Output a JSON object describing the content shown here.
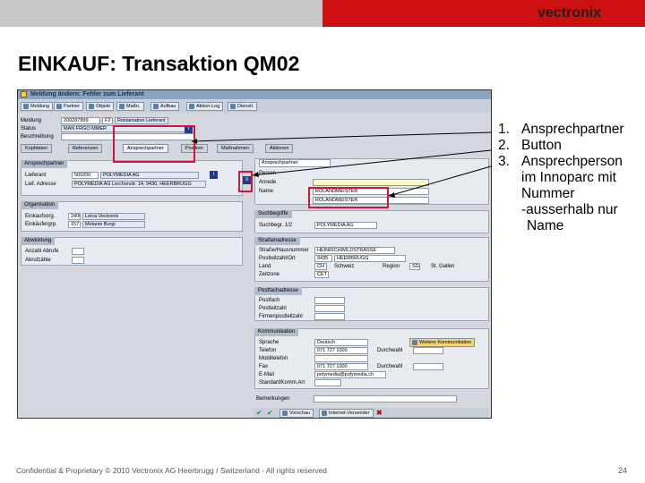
{
  "header": {
    "logo": "vectronix",
    "title": "EINKAUF: Transaktion QM02"
  },
  "footer": {
    "text": "Confidential & Proprietary © 2010 Vectronix AG Heerbrugg / Switzerland - All rights reserved",
    "page": "24"
  },
  "callouts": [
    {
      "num": "1.",
      "lines": [
        "Ansprechpartner"
      ]
    },
    {
      "num": "2.",
      "lines": [
        "Button"
      ]
    },
    {
      "num": "3.",
      "lines": [
        "Ansprechperson",
        "im Innoparc mit",
        "Nummer",
        "-ausserhalb nur",
        "Name"
      ]
    }
  ],
  "sap": {
    "window_title": "Meldung ändern: Fehler zum Lieferant",
    "toolbar": [
      "Meldung",
      "Partner",
      "Objekt",
      "Maßn.",
      "Aufbau",
      "Aktion-Log",
      "Dienstl."
    ],
    "header_fields": {
      "meldung_label": "Meldung",
      "meldung_value": "200287899",
      "type_value": "F2",
      "type_text": "Reklamation Lieferant",
      "status_label": "Status",
      "status_value": "MAN FRGO MMER",
      "beschreibung_label": "Beschreibung"
    },
    "tabs": [
      "Kopfdaten",
      "Referenzen",
      "Ansprechpartner",
      "Position",
      "Maßnahmen",
      "Aktionen"
    ],
    "left_groups": {
      "ansprechpartner": {
        "title": "Ansprechpartner",
        "lieferant_label": "Lieferant",
        "lieferant_no": "500200",
        "lieferant_name": "POLYMEDIA AG",
        "adresse_label": "Lief. Adresse",
        "adresse_value": "POLYMEDIA AG Lerchenstr. 14, 9430, HEERBRUGG"
      },
      "organisation": {
        "title": "Organisation",
        "einkaufsorg_label": "Einkaufsorg.",
        "einkaufsorg_no": "2400",
        "einkaufsorg_value": "Leica Vectronix",
        "einkaeufer_label": "Einkäufergrp.",
        "einkaeufer_no": "157",
        "einkaeufer_value": "Melanie Burgi"
      },
      "abwicklung": {
        "title": "Abwicklung",
        "anz_label": "Anzahl Abrufe",
        "abrufe_label": "Abrufzähle"
      }
    },
    "right_groups": {
      "person": {
        "title": "Person",
        "select_text": "Ansprechpartner",
        "anrede_label": "Anrede",
        "name_label": "Name",
        "name_value": "ROLANDMEISTER",
        "vorname_value": "ROLANDMEISTER"
      },
      "suchbegriffe": {
        "title": "Suchbegriffe",
        "label": "Suchbegr. 1/2",
        "value": "POLYMEDIA AG"
      },
      "strasse": {
        "title": "Straßenadresse",
        "strasse_label": "Straße/Hausnummer",
        "strasse_value": "HEINRICHWILDSTRASSE",
        "ort_label": "Postleitzahl/Ort",
        "plz_value": "9435",
        "ort_value": "HEERBRUGG",
        "land_label": "Land",
        "land_value": "CH",
        "land_text": "Schweiz",
        "region_label": "Region",
        "region_value": "SG",
        "region_text": "St. Gallen",
        "zeitzone_label": "Zeitzone",
        "zeitzone_value": "CET"
      },
      "postfach": {
        "title": "Postfachadresse",
        "postfach_label": "Postfach",
        "plz_label": "Postleitzahl",
        "firma_label": "Firmenpostleitzahl"
      },
      "kommunikation": {
        "title": "Kommunikation",
        "sprache_label": "Sprache",
        "sprache_value": "Deutsch",
        "more_btn": "Weitere Kommunikation",
        "telefon_label": "Telefon",
        "telefon_value": "071 727 1000",
        "durchwahl_label": "Durchwahl",
        "mobil_label": "Mobiltelefon",
        "fax_label": "Fax",
        "fax_value": "071 727 1000",
        "fax_durchwahl_label": "Durchwahl",
        "email_label": "E-Mail",
        "email_value": "polymedia@polymedia.ch",
        "standard_label": "StandardKomm.Art"
      },
      "bemerkungen_label": "Bemerkungen"
    },
    "bottom_buttons": [
      "Vorschau",
      "Internet-Versender"
    ]
  }
}
